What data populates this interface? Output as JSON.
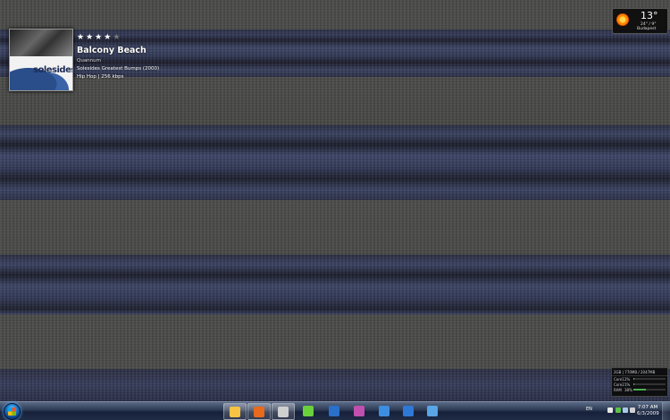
{
  "now_playing": {
    "rating": 4,
    "rating_max": 5,
    "title": "Balcony Beach",
    "artist": "Quannum",
    "album": "Solesides Greatest Bumps (2000)",
    "meta": "Hip Hop | 256 kbps",
    "cover_text": "solesides"
  },
  "weather": {
    "temperature": "13°",
    "high_low": "24° / 9°",
    "city": "Budapest",
    "icon": "sun-icon"
  },
  "system_monitor": {
    "memory": "2GB | 770MB / 2047MB",
    "cores": [
      {
        "label": "Core1",
        "value": "2%",
        "level": 0.02
      },
      {
        "label": "Core2",
        "value": "1%",
        "level": 0.01
      }
    ],
    "ram": {
      "label": "RAM",
      "value": "38%",
      "level": 0.38
    }
  },
  "taskbar": {
    "pinned": [
      {
        "name": "weather-gadget-icon",
        "color": "#f6c343",
        "active": true
      },
      {
        "name": "firefox-icon",
        "color": "#e86a1c",
        "active": true
      },
      {
        "name": "media-player-icon",
        "color": "#cfcfcf",
        "active": true
      },
      {
        "name": "favorites-star-icon",
        "color": "#6ad03c",
        "active": false
      },
      {
        "name": "photoshop-icon",
        "color": "#2a6fc9",
        "active": false
      },
      {
        "name": "flash-icon",
        "color": "#c14fb0",
        "active": false
      },
      {
        "name": "messenger-icon",
        "color": "#3d8ee0",
        "active": false
      },
      {
        "name": "download-icon",
        "color": "#2f79d6",
        "active": false
      },
      {
        "name": "notes-icon",
        "color": "#58a6e6",
        "active": false
      }
    ],
    "language": "EN",
    "time": "7:07 AM",
    "date": "6/3/2009"
  }
}
